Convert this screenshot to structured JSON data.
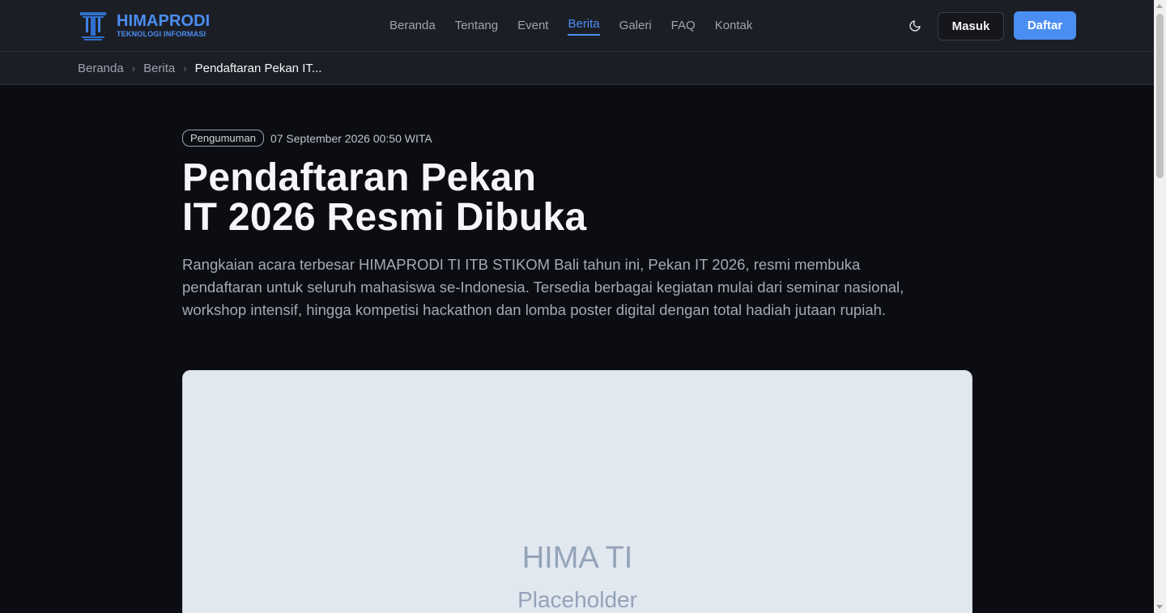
{
  "header": {
    "brand_title": "HIMAPRODI",
    "brand_subtitle": "TEKNOLOGI INFORMASI",
    "logo_icon": "tower-pillar-logo",
    "nav": [
      {
        "label": "Beranda",
        "active": false
      },
      {
        "label": "Tentang",
        "active": false
      },
      {
        "label": "Event",
        "active": false
      },
      {
        "label": "Berita",
        "active": true
      },
      {
        "label": "Galeri",
        "active": false
      },
      {
        "label": "FAQ",
        "active": false
      },
      {
        "label": "Kontak",
        "active": false
      }
    ],
    "theme_icon": "moon-icon",
    "login_label": "Masuk",
    "register_label": "Daftar"
  },
  "breadcrumb": {
    "items": [
      "Beranda",
      "Berita",
      "Pendaftaran Pekan IT..."
    ]
  },
  "article": {
    "category": "Pengumuman",
    "date": "07 September 2026 00:50 WITA",
    "title_line1": "Pendaftaran Pekan",
    "title_line2": "IT 2026 Resmi Dibuka",
    "lead": "Rangkaian acara terbesar HIMAPRODI TI ITB STIKOM Bali tahun ini, Pekan IT 2026, resmi membuka pendaftaran untuk seluruh mahasiswa se-Indonesia. Tersedia berbagai kegiatan mulai dari seminar nasional, workshop intensif, hingga kompetisi hackathon dan lomba poster digital dengan total hadiah jutaan rupiah.",
    "image_text": "HIMA TI",
    "image_subtext": "Placeholder"
  },
  "colors": {
    "accent": "#4a8ef2",
    "background": "#0c0d12",
    "header_bg": "#1c1e26"
  }
}
